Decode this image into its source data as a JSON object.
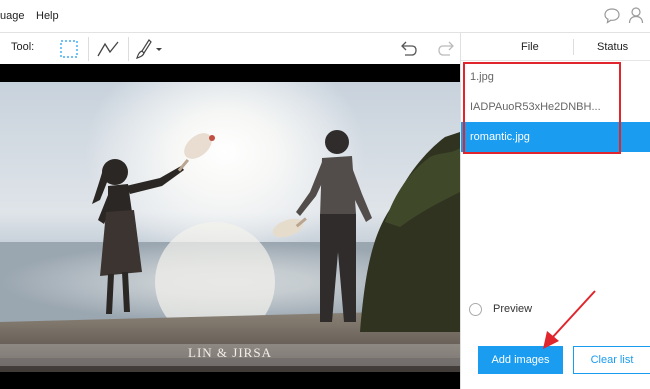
{
  "menu": {
    "language_label": "uage",
    "help_label": "Help"
  },
  "toolbar": {
    "tool_label": "Tool:",
    "tools": [
      "rectangle-select-icon",
      "polyline-icon",
      "brush-icon"
    ],
    "undo_icon": "undo-icon",
    "redo_icon": "redo-icon"
  },
  "canvas": {
    "watermark": "LIN & JIRSA"
  },
  "panel": {
    "columns": {
      "file": "File",
      "status": "Status"
    },
    "files": [
      {
        "name": "1.jpg",
        "selected": false
      },
      {
        "name": "IADPAuoR53xHe2DNBH...",
        "selected": false
      },
      {
        "name": "romantic.jpg",
        "selected": true
      }
    ],
    "preview_label": "Preview",
    "add_images_label": "Add images",
    "clear_list_label": "Clear list"
  },
  "colors": {
    "accent": "#1a9cf0",
    "highlight": "#e0262c"
  }
}
